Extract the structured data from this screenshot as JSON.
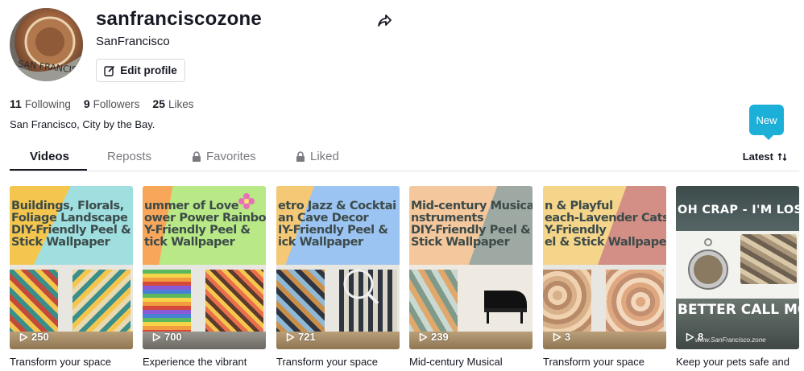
{
  "profile": {
    "username": "sanfranciscozone",
    "nickname": "SanFrancisco",
    "edit_label": "Edit profile",
    "bio": "San Francisco, City by the Bay.",
    "avatar_text": "SAN FRANCISCO"
  },
  "stats": [
    {
      "value": "11",
      "label": "Following"
    },
    {
      "value": "9",
      "label": "Followers"
    },
    {
      "value": "25",
      "label": "Likes"
    }
  ],
  "new_badge": "New",
  "tabs": {
    "videos": "Videos",
    "reposts": "Reposts",
    "favorites": "Favorites",
    "liked": "Liked",
    "sort": "Latest"
  },
  "videos": [
    {
      "banner": "Buildings, Florals,\nFoliage Landscape\nDIY-Friendly Peel &\nStick Wallpaper",
      "views": "250",
      "caption": "Transform your space",
      "colors": [
        "#9fdfe0",
        "#f5c64d",
        "#3a8f8a"
      ]
    },
    {
      "banner": "ummer of Love\nower Power Rainbo\nY-Friendly Peel &\ntick Wallpaper",
      "views": "700",
      "caption": "Experience the vibrant",
      "colors": [
        "#b8e986",
        "#f7a65a",
        "#a86ad6"
      ]
    },
    {
      "banner": "etro Jazz & Cocktai\nan Cave Decor\nIY-Friendly Peel &\nick Wallpaper",
      "views": "721",
      "caption": "Transform your space",
      "colors": [
        "#9bc4f2",
        "#f5c876",
        "#2e3440"
      ]
    },
    {
      "banner": "Mid-century Musical\nnstruments\nDIY-Friendly Peel &\nStick Wallpaper",
      "views": "239",
      "caption": "Mid-century Musical",
      "colors": [
        "#9fa9a3",
        "#f4c79c",
        "#c9d8d0"
      ]
    },
    {
      "banner": "n & Playful\neach-Lavender Cats\nY-Friendly\nel & Stick Wallpape",
      "views": "3",
      "caption": "Transform your space",
      "colors": [
        "#d38f85",
        "#f4d58a",
        "#c28b6a"
      ]
    },
    {
      "top": "OH CRAP - I'M LOST!",
      "bottom": "BETTER CALL MOM",
      "url": "www.SanFrancisco.zone",
      "views": "8",
      "caption": "Keep your pets safe and"
    }
  ]
}
